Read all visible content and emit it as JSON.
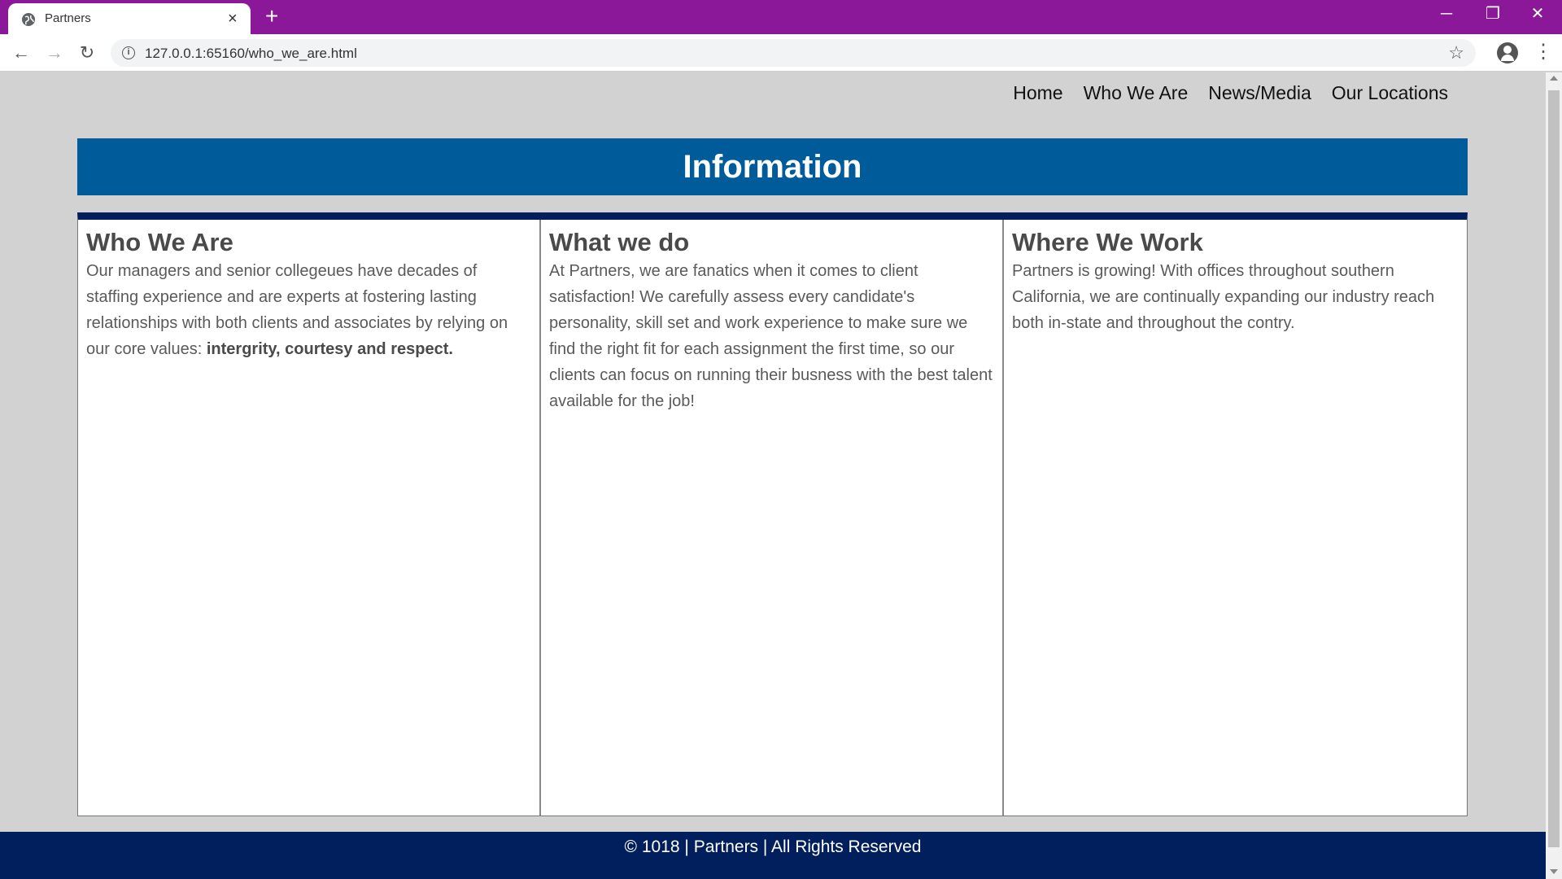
{
  "browser": {
    "tab_title": "Partners",
    "tab_close": "×",
    "new_tab": "+",
    "url": "127.0.0.1:65160/who_we_are.html",
    "window_controls": {
      "minimize": "─",
      "maximize": "❐",
      "close": "✕"
    }
  },
  "nav": {
    "home": "Home",
    "who_we_are": "Who We Are",
    "news_media": "News/Media",
    "our_locations": "Our Locations"
  },
  "banner": {
    "title": "Information"
  },
  "columns": [
    {
      "heading": "Who We Are",
      "text": "Our managers and senior collegeues have decades of staffing experience and are experts at fostering lasting relationships with both clients and associates by relying on our core values: ",
      "bold": "intergrity, courtesy and respect."
    },
    {
      "heading": "What we do",
      "text": "At Partners, we are fanatics when it comes to client satisfaction! We carefully assess every candidate's personality, skill set and work experience to make sure we find the right fit for each assignment the first time, so our clients can focus on running their busness with the best talent available for the job!"
    },
    {
      "heading": "Where We Work",
      "text": "Partners is growing! With offices throughout southern California, we are continually expanding our industry reach both in-state and throughout the contry."
    }
  ],
  "footer": {
    "text": "© 1018 | Partners | All Rights Reserved"
  },
  "colors": {
    "titlebar": "#8a1898",
    "banner": "#005b9a",
    "footer": "#001f5c",
    "page_background": "#d2d2d2"
  }
}
